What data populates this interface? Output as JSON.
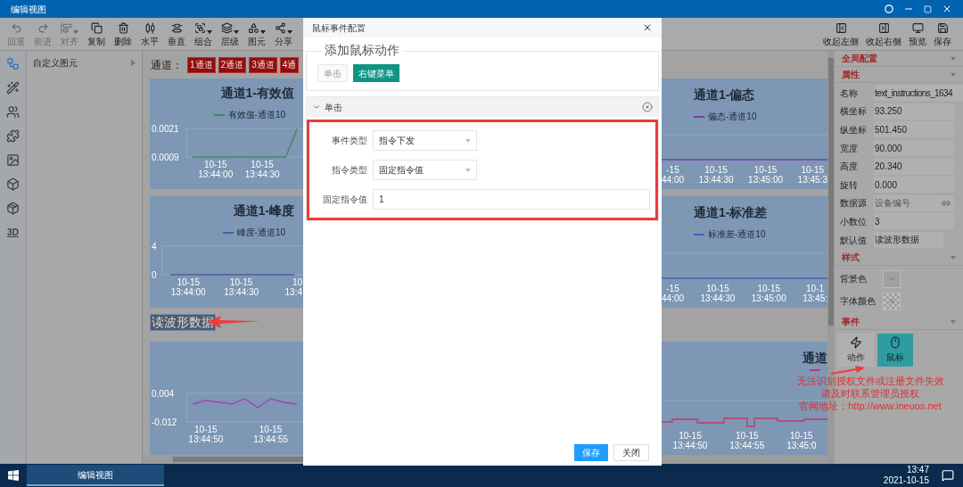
{
  "window": {
    "title": "编辑视图"
  },
  "toolbar": {
    "left": [
      {
        "label": "回退",
        "disabled": true,
        "dropdown": false
      },
      {
        "label": "前进",
        "disabled": true,
        "dropdown": false
      },
      {
        "label": "对齐",
        "disabled": true,
        "dropdown": true
      },
      {
        "label": "复制",
        "disabled": false,
        "dropdown": false
      },
      {
        "label": "删除",
        "disabled": false,
        "dropdown": false
      },
      {
        "label": "水平",
        "disabled": false,
        "dropdown": false
      },
      {
        "label": "垂直",
        "disabled": false,
        "dropdown": false
      },
      {
        "label": "组合",
        "disabled": false,
        "dropdown": true
      },
      {
        "label": "层级",
        "disabled": false,
        "dropdown": true
      },
      {
        "label": "图元",
        "disabled": false,
        "dropdown": true
      },
      {
        "label": "分享",
        "disabled": false,
        "dropdown": true
      }
    ],
    "right": [
      {
        "label": "收起左侧"
      },
      {
        "label": "收起右侧"
      },
      {
        "label": "预览"
      },
      {
        "label": "保存"
      }
    ]
  },
  "tool_rail": [
    {
      "selected": true
    },
    {
      "selected": false
    },
    {
      "selected": false
    },
    {
      "selected": false
    },
    {
      "selected": false
    },
    {
      "selected": false
    },
    {
      "selected": false
    },
    {
      "selected": false,
      "text": "3D"
    }
  ],
  "palette": {
    "title": "自定义图元"
  },
  "canvas": {
    "channel_label": "通道：",
    "channel_buttons": [
      "1通道",
      "2通道",
      "3通道",
      "4通"
    ],
    "selected_text": "读波形数据",
    "charts_left": [
      {
        "title": "通道1-有效值",
        "chart_data": {
          "type": "line",
          "ylim": [
            0.0009,
            0.0021
          ],
          "yticks": [
            0.0021,
            0.0009
          ],
          "categories": [
            null,
            null,
            "10-15\n13:44:00",
            null,
            null,
            null,
            "10-15\n13:44:30",
            null,
            null,
            null
          ],
          "series": [
            {
              "name": "有效值-通道10",
              "color": "#3f8a5c",
              "values": [
                0.0009,
                0.0009,
                0.0009,
                0.0009,
                0.0009,
                0.0009,
                0.0009,
                0.0009,
                0.0009,
                0.0021
              ]
            }
          ]
        }
      },
      {
        "title": "通道1-峰度",
        "chart_data": {
          "type": "line",
          "ylim": [
            0,
            4
          ],
          "yticks": [
            4,
            0
          ],
          "categories": [
            null,
            "10-15\n13:44:00",
            null,
            null,
            "10-15\n13:44:30",
            null,
            null,
            "10\n13:4"
          ],
          "series": [
            {
              "name": "峰度-通道10",
              "color": "#4a5fa0",
              "values": [
                0,
                0,
                0,
                0,
                0,
                0,
                0,
                0
              ]
            }
          ]
        }
      },
      {
        "chart_data": {
          "type": "line",
          "ylim": [
            -0.012,
            0.004
          ],
          "yticks": [
            0.004,
            -0.012
          ],
          "categories": [
            null,
            "10-15\n13:44:50",
            null,
            null,
            null,
            null,
            "10-15\n13:44:55",
            null,
            null
          ],
          "series": [
            {
              "color": "#b03ab8",
              "values": [
                -0.002,
                0,
                -0.001,
                -0.002,
                0.001,
                -0.004,
                0.001,
                -0.001,
                -0.002
              ]
            }
          ]
        }
      }
    ],
    "charts_right": [
      {
        "title": "通道1-偏态",
        "legend": "偏态-通道10",
        "color": "#7b3fb0",
        "xtick_labels": [
          "-15\n44:00",
          "10-15\n13:44:30",
          "10-15\n13:45:00",
          "10-15\n13:45:3"
        ]
      },
      {
        "title": "通道1-标准差",
        "legend": "标准差-通道10",
        "color": "#4a5fc0",
        "xtick_labels": [
          "-15\n44:00",
          "10-15\n13:44:30",
          "10-15\n13:45:00",
          "10-1\n13:45:"
        ]
      },
      {
        "title": "通道",
        "color": "#c03a6a",
        "xtick_labels": [
          "10-15\n13:44:50",
          "10-15\n13:44:55",
          "10-15\n13:45:0"
        ]
      }
    ]
  },
  "dialog": {
    "title": "鼠标事件配置",
    "add_section": {
      "legend": "添加鼠标动作",
      "buttons": [
        {
          "label": "单击",
          "disabled": true
        },
        {
          "label": "右键菜单",
          "disabled": false
        }
      ]
    },
    "panel": {
      "title": "单击",
      "expanded": true,
      "fields": [
        {
          "kind": "select",
          "label": "事件类型",
          "value": "指令下发"
        },
        {
          "kind": "select",
          "label": "指令类型",
          "value": "固定指令值"
        },
        {
          "kind": "input",
          "label": "固定指令值",
          "value": "1"
        }
      ]
    },
    "buttons": [
      {
        "label": "保存",
        "kind": "primary"
      },
      {
        "label": "关闭",
        "kind": "default"
      }
    ]
  },
  "properties": {
    "global": {
      "title": "全局配置"
    },
    "attributes": {
      "title": "属性",
      "fields": [
        {
          "label": "名称",
          "value": "text_instructions_1634"
        },
        {
          "label": "横坐标",
          "value": "93.250"
        },
        {
          "label": "纵坐标",
          "value": "501.450"
        },
        {
          "label": "宽度",
          "value": "90.000"
        },
        {
          "label": "高度",
          "value": "20.340"
        },
        {
          "label": "旋转",
          "value": "0.000"
        },
        {
          "label": "数据源",
          "placeholder": "设备编号",
          "kind": "link"
        },
        {
          "label": "小数位",
          "value": "3"
        },
        {
          "label": "默认值",
          "value": "读波形数据"
        }
      ]
    },
    "style": {
      "title": "样式",
      "fields": [
        {
          "label": "背景色",
          "kind": "color"
        },
        {
          "label": "字体颜色",
          "kind": "transparent"
        }
      ]
    },
    "events": {
      "title": "事件",
      "buttons": [
        {
          "label": "动作",
          "selected": false
        },
        {
          "label": "鼠标",
          "selected": true
        }
      ]
    }
  },
  "license_notice": [
    "无法识别授权文件或注册文件失效",
    "请及时联系管理员授权",
    "官网地址：http://www.ineuos.net"
  ],
  "taskbar": {
    "task": "编辑视图",
    "time": "13:47",
    "date": "2021-10-15"
  }
}
